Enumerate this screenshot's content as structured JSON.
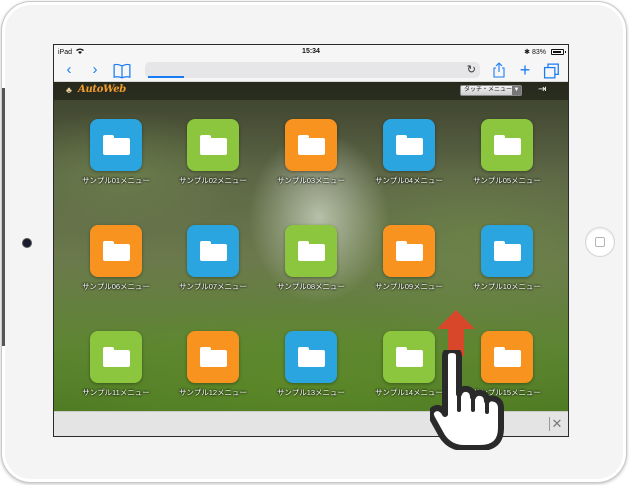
{
  "status": {
    "device": "iPad",
    "time": "15:34",
    "battery": "83%"
  },
  "site": {
    "logo_text": "AutoWeb",
    "menu_select": "タッチ・メニュー"
  },
  "icons": {
    "back": "chevron-left-icon",
    "forward": "chevron-right-icon",
    "bookmarks": "book-icon",
    "reload": "reload-icon",
    "share": "share-icon",
    "add": "plus-icon",
    "tabs": "tabs-icon",
    "logout": "logout-icon",
    "folder": "folder-icon",
    "close": "close-icon"
  },
  "colors": {
    "blue": "#2aa5df",
    "green": "#8cc63f",
    "orange": "#f7931e",
    "accent": "#1a7cf5",
    "arrow": "#d9472b"
  },
  "menu_items": [
    {
      "label": "サンプル01メニュー",
      "color": "#2aa5df"
    },
    {
      "label": "サンプル02メニュー",
      "color": "#8cc63f"
    },
    {
      "label": "サンプル03メニュー",
      "color": "#f7931e"
    },
    {
      "label": "サンプル04メニュー",
      "color": "#2aa5df"
    },
    {
      "label": "サンプル05メニュー",
      "color": "#8cc63f"
    },
    {
      "label": "サンプル06メニュー",
      "color": "#f7931e"
    },
    {
      "label": "サンプル07メニュー",
      "color": "#2aa5df"
    },
    {
      "label": "サンプル08メニュー",
      "color": "#8cc63f"
    },
    {
      "label": "サンプル09メニュー",
      "color": "#f7931e"
    },
    {
      "label": "サンプル10メニュー",
      "color": "#2aa5df"
    },
    {
      "label": "サンプル11メニュー",
      "color": "#8cc63f"
    },
    {
      "label": "サンプル12メニュー",
      "color": "#f7931e"
    },
    {
      "label": "サンプル13メニュー",
      "color": "#2aa5df"
    },
    {
      "label": "サンプル14メニュー",
      "color": "#8cc63f"
    },
    {
      "label": "サンプル15メニュー",
      "color": "#f7931e"
    }
  ]
}
